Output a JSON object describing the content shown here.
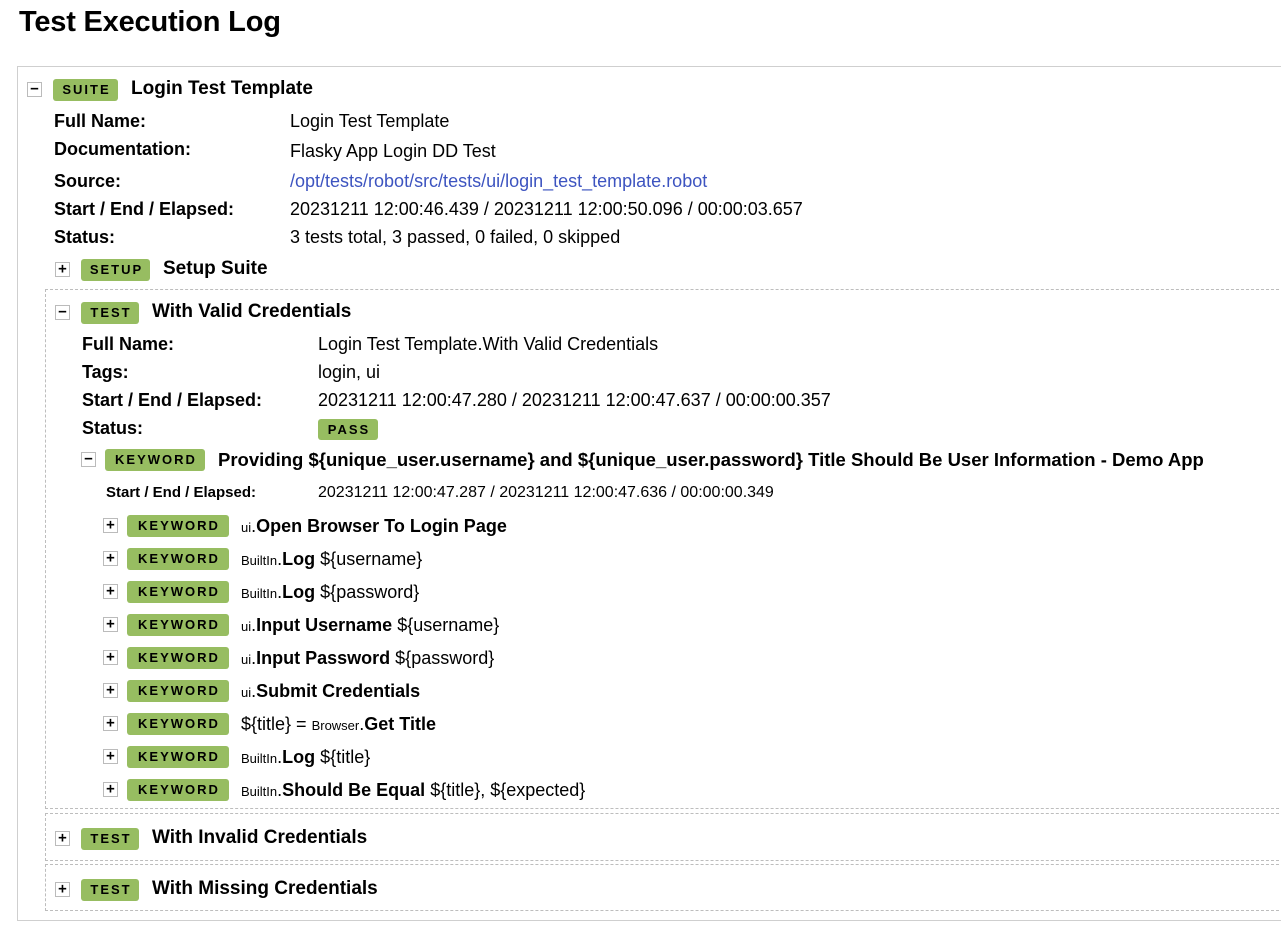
{
  "page": {
    "title": "Test Execution Log"
  },
  "suite": {
    "badge": "SUITE",
    "name": "Login Test Template",
    "labels": {
      "full_name": "Full Name:",
      "documentation": "Documentation:",
      "source": "Source:",
      "times": "Start / End / Elapsed:",
      "status": "Status:"
    },
    "full_name": "Login Test Template",
    "documentation": "Flasky App Login DD Test",
    "source": "/opt/tests/robot/src/tests/ui/login_test_template.robot",
    "times": "20231211 12:00:46.439 / 20231211 12:00:50.096 / 00:00:03.657",
    "status": "3 tests total, 3 passed, 0 failed, 0 skipped",
    "setup": {
      "badge": "SETUP",
      "name": "Setup Suite",
      "toggle": "+"
    },
    "toggle": "−"
  },
  "test1": {
    "badge": "TEST",
    "name": "With Valid Credentials",
    "toggle": "−",
    "labels": {
      "full_name": "Full Name:",
      "tags": "Tags:",
      "times": "Start / End / Elapsed:",
      "status": "Status:"
    },
    "full_name": "Login Test Template.With Valid Credentials",
    "tags": "login, ui",
    "times": "20231211 12:00:47.280 / 20231211 12:00:47.637 / 00:00:00.357",
    "status_badge": "PASS",
    "keyword": {
      "badge": "KEYWORD",
      "toggle": "−",
      "name": "Providing ${unique_user.username} and ${unique_user.password} Title Should Be User Information - Demo App",
      "times_label": "Start / End / Elapsed:",
      "times": "20231211 12:00:47.287 / 20231211 12:00:47.636 / 00:00:00.349",
      "children": [
        {
          "badge": "KEYWORD",
          "toggle": "+",
          "assign": "",
          "lib": "ui",
          "dot": ".",
          "name": "Open Browser To Login Page",
          "args": ""
        },
        {
          "badge": "KEYWORD",
          "toggle": "+",
          "assign": "",
          "lib": "BuiltIn",
          "dot": ".",
          "name": "Log",
          "args": "${username}"
        },
        {
          "badge": "KEYWORD",
          "toggle": "+",
          "assign": "",
          "lib": "BuiltIn",
          "dot": ".",
          "name": "Log",
          "args": "${password}"
        },
        {
          "badge": "KEYWORD",
          "toggle": "+",
          "assign": "",
          "lib": "ui",
          "dot": ".",
          "name": "Input Username",
          "args": "${username}"
        },
        {
          "badge": "KEYWORD",
          "toggle": "+",
          "assign": "",
          "lib": "ui",
          "dot": ".",
          "name": "Input Password",
          "args": "${password}"
        },
        {
          "badge": "KEYWORD",
          "toggle": "+",
          "assign": "",
          "lib": "ui",
          "dot": ".",
          "name": "Submit Credentials",
          "args": ""
        },
        {
          "badge": "KEYWORD",
          "toggle": "+",
          "assign": "${title} = ",
          "lib": "Browser",
          "dot": ".",
          "name": "Get Title",
          "args": ""
        },
        {
          "badge": "KEYWORD",
          "toggle": "+",
          "assign": "",
          "lib": "BuiltIn",
          "dot": ".",
          "name": "Log",
          "args": "${title}"
        },
        {
          "badge": "KEYWORD",
          "toggle": "+",
          "assign": "",
          "lib": "BuiltIn",
          "dot": ".",
          "name": "Should Be Equal",
          "args": "${title}, ${expected}"
        }
      ]
    }
  },
  "test2": {
    "badge": "TEST",
    "name": "With Invalid Credentials",
    "toggle": "+"
  },
  "test3": {
    "badge": "TEST",
    "name": "With Missing Credentials",
    "toggle": "+"
  },
  "colors": {
    "badge_green": "#97bd61",
    "link_blue": "#3d54c0"
  }
}
